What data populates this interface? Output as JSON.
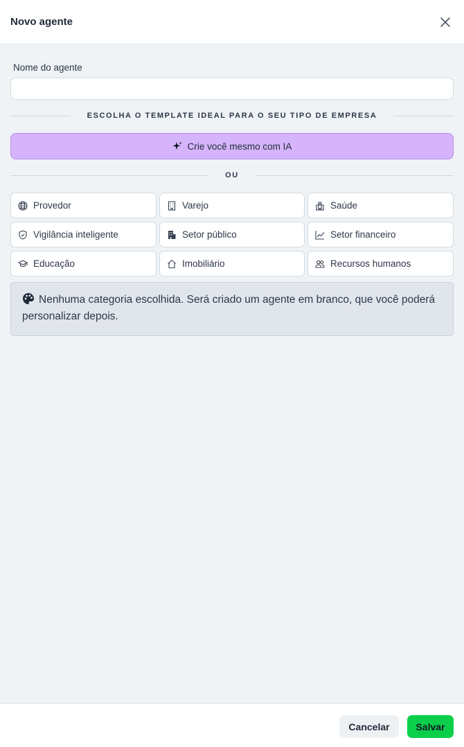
{
  "dialog": {
    "title": "Novo agente"
  },
  "form": {
    "name_label": "Nome do agente",
    "name_value": "",
    "name_placeholder": ""
  },
  "templates": {
    "heading": "ESCOLHA O TEMPLATE IDEAL PARA O SEU TIPO DE EMPRESA",
    "ai_button_label": "Crie você mesmo com IA",
    "or_label": "OU",
    "categories": [
      {
        "label": "Provedor",
        "icon": "globe-icon"
      },
      {
        "label": "Varejo",
        "icon": "building-icon"
      },
      {
        "label": "Saúde",
        "icon": "hospital-icon"
      },
      {
        "label": "Vigilância inteligente",
        "icon": "shield-icon"
      },
      {
        "label": "Setor público",
        "icon": "government-building-icon"
      },
      {
        "label": "Setor financeiro",
        "icon": "line-chart-icon"
      },
      {
        "label": "Educação",
        "icon": "graduation-cap-icon"
      },
      {
        "label": "Imobiliário",
        "icon": "house-icon"
      },
      {
        "label": "Recursos humanos",
        "icon": "users-icon"
      }
    ]
  },
  "info": {
    "icon": "palette-icon",
    "text": "Nenhuma categoria escolhida. Será criado um agente em branco, que você poderá personalizar depois."
  },
  "footer": {
    "cancel_label": "Cancelar",
    "save_label": "Salvar"
  },
  "colors": {
    "ai_button_bg": "#d5b4fb",
    "save_button_bg": "#0bcf4a",
    "page_bg": "#eff3f6"
  }
}
